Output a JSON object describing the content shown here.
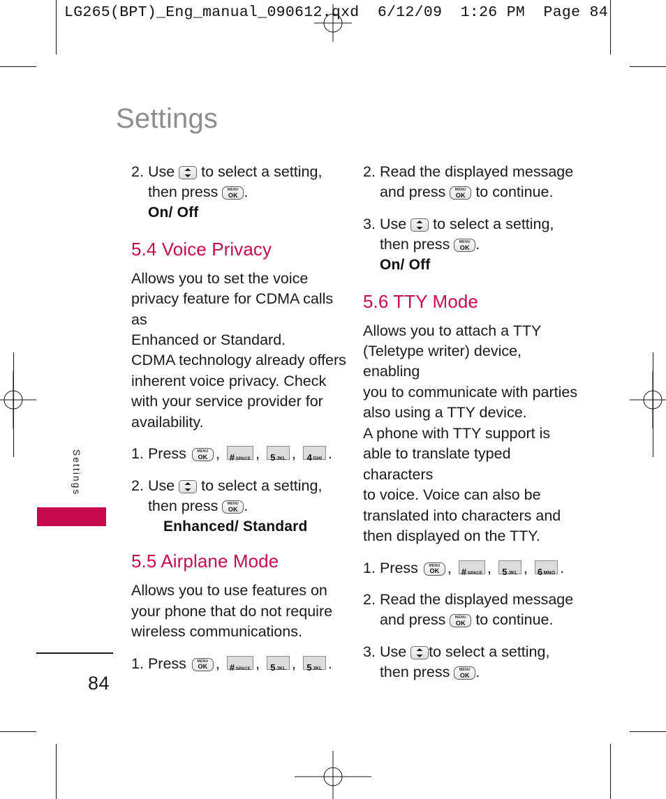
{
  "file_header": "LG265(BPT)_Eng_manual_090612.qxd  6/12/09  1:26 PM  Page 84",
  "chapter_title": "Settings",
  "side_tab": {
    "label": "Settings"
  },
  "page_number": "84",
  "keys": {
    "menu_top": "MENU",
    "menu_bottom": "OK",
    "hash_digit": "#",
    "hash_label": "SPACE",
    "k5_digit": "5",
    "k5_label": "JKL",
    "k4_digit": "4",
    "k4_label": "GHI",
    "k6_digit": "6",
    "k6_label": "MNO"
  },
  "left_column": {
    "step_2": {
      "num": "2.",
      "line1_a": "Use",
      "line1_b": "to select a setting,",
      "line2_a": "then press",
      "line2_b": ".",
      "value": "On/ Off"
    },
    "section_54": {
      "heading": "5.4 Voice Privacy",
      "paragraph": [
        "Allows you to set the voice",
        "privacy feature for CDMA calls as",
        "Enhanced or Standard.",
        "CDMA technology already offers",
        "inherent voice privacy. Check",
        "with your service provider for",
        "availability."
      ],
      "step_1": {
        "num": "1.",
        "label": "Press",
        "comma": ",",
        "period": "."
      },
      "step_2": {
        "num": "2.",
        "line1_a": "Use",
        "line1_b": "to select a setting,",
        "line2_a": "then press",
        "line2_b": ".",
        "value": "Enhanced/ Standard"
      }
    },
    "section_55": {
      "heading": "5.5 Airplane Mode",
      "paragraph": [
        "Allows you to use features on",
        "your phone that do not require",
        "wireless communications."
      ],
      "step_1": {
        "num": "1.",
        "label": "Press",
        "comma": ",",
        "period": "."
      }
    }
  },
  "right_column": {
    "step_2": {
      "num": "2.",
      "line1": "Read the displayed message",
      "line2_a": "and press",
      "line2_b": "to continue."
    },
    "step_3": {
      "num": "3.",
      "line1_a": "Use",
      "line1_b": "to select a setting,",
      "line2_a": "then press",
      "line2_b": ".",
      "value": "On/ Off"
    },
    "section_56": {
      "heading": "5.6 TTY Mode",
      "paragraph": [
        "Allows you to attach a TTY",
        "(Teletype writer) device, enabling",
        "you to communicate with parties",
        "also using a TTY device.",
        "A phone with TTY support is",
        "able to translate typed characters",
        "to voice. Voice can also be",
        "translated into characters and",
        "then displayed on the TTY."
      ],
      "step_1": {
        "num": "1.",
        "label": "Press",
        "comma": ",",
        "period": "."
      },
      "step_2": {
        "num": "2.",
        "line1": "Read the displayed message",
        "line2_a": "and press",
        "line2_b": "to continue."
      },
      "step_3": {
        "num": "3.",
        "line1_a": "Use",
        "line1_b": "to select a setting,",
        "line2_a": "then press",
        "line2_b": "."
      }
    }
  },
  "colors": {
    "accent": "#c70a4d",
    "title_gray": "#8d8d8d",
    "body": "#1a1a1a"
  }
}
